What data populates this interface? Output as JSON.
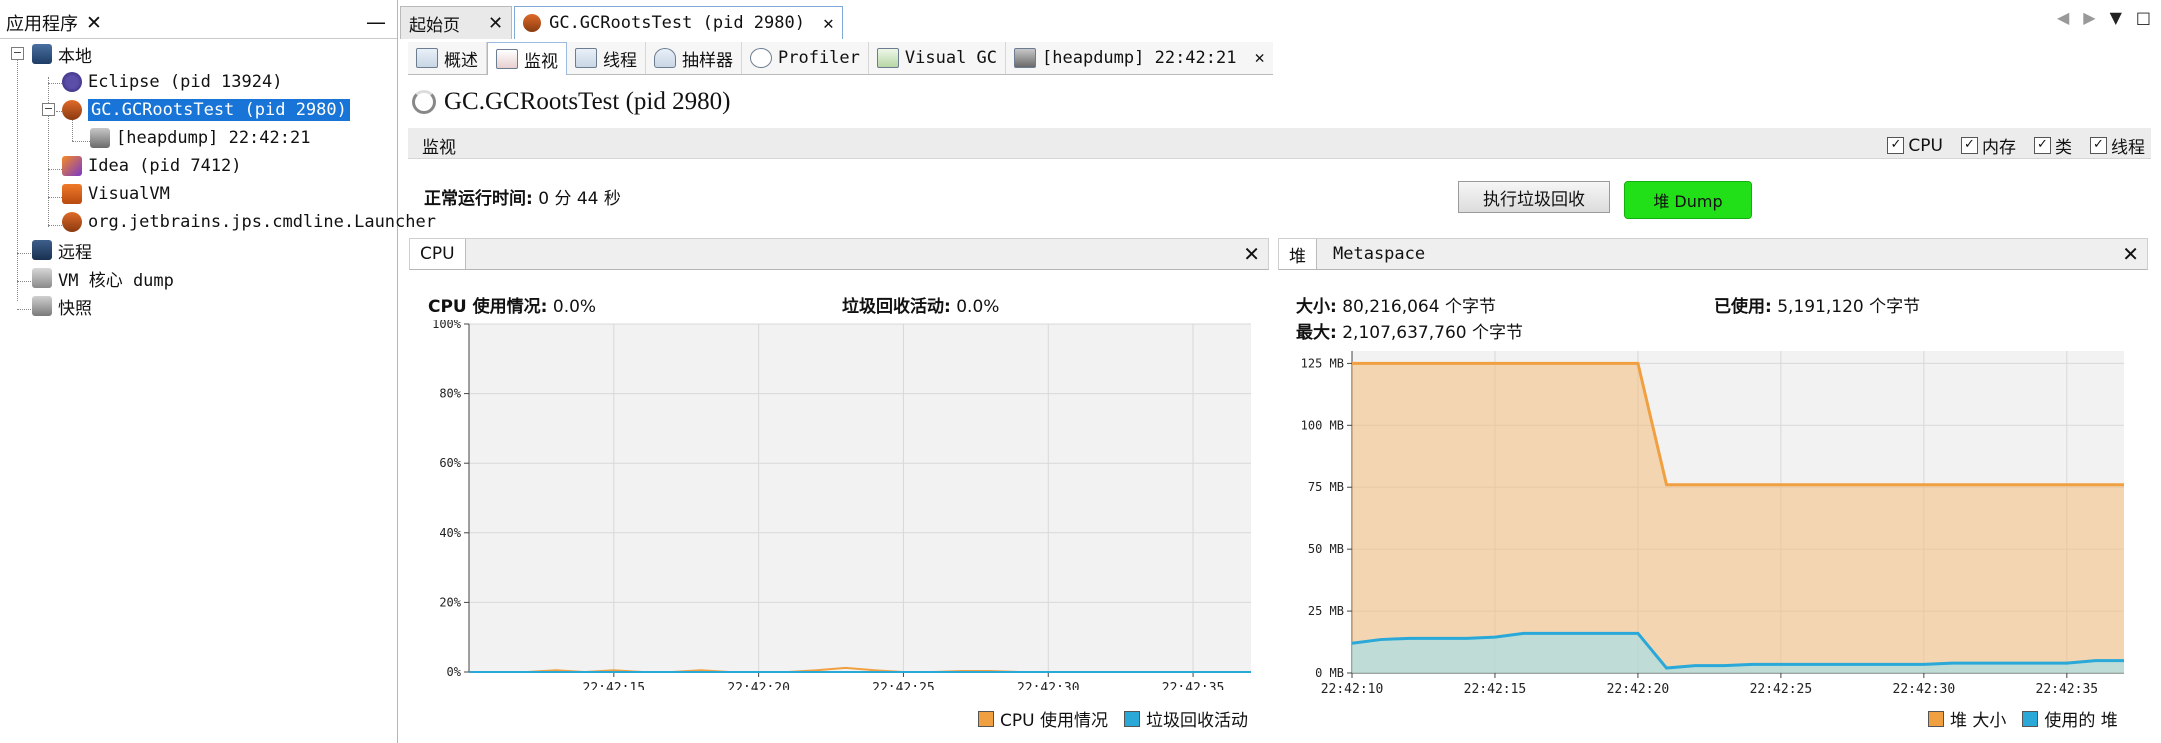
{
  "left_panel": {
    "tab_label": "应用程序",
    "close": "✕",
    "minimize": "—",
    "tree": {
      "local": "本地",
      "eclipse": "Eclipse (pid 13924)",
      "gcroots": "GC.GCRootsTest (pid 2980)",
      "heapdump": "[heapdump] 22:42:21",
      "idea": "Idea (pid 7412)",
      "visualvm": "VisualVM",
      "launcher": "org.jetbrains.jps.cmdline.Launcher",
      "remote": "远程",
      "coredump": "VM 核心 dump",
      "snapshot": "快照"
    },
    "toggle_minus": "−"
  },
  "main_tabs": [
    {
      "label": "起始页"
    },
    {
      "label": "GC.GCRootsTest (pid 2980)"
    }
  ],
  "close_x": "✕",
  "nav": {
    "left": "◀",
    "right": "▶",
    "down": "▼",
    "max": "□"
  },
  "sub_tabs": [
    {
      "label": "概述"
    },
    {
      "label": "监视"
    },
    {
      "label": "线程"
    },
    {
      "label": "抽样器"
    },
    {
      "label": "Profiler"
    },
    {
      "label": "Visual GC"
    },
    {
      "label": "[heapdump] 22:42:21"
    }
  ],
  "process_title": "GC.GCRootsTest (pid 2980)",
  "monitor": {
    "label": "监视",
    "checks": [
      {
        "label": "CPU",
        "checked": true
      },
      {
        "label": "内存",
        "checked": true
      },
      {
        "label": "类",
        "checked": true
      },
      {
        "label": "线程",
        "checked": true
      }
    ],
    "check_mark": "✓"
  },
  "uptime": {
    "label": "正常运行时间:",
    "value": "0 分 44 秒"
  },
  "buttons": {
    "gc": "执行垃圾回收",
    "heap_dump": "堆 Dump"
  },
  "cpu_panel": {
    "tab": "CPU",
    "usage_label": "CPU 使用情况:",
    "usage_value": "0.0%",
    "gc_label": "垃圾回收活动:",
    "gc_value": "0.0%",
    "legend": [
      "CPU 使用情况",
      "垃圾回收活动"
    ]
  },
  "heap_panel": {
    "tabs": [
      "堆",
      "Metaspace"
    ],
    "size_label": "大小:",
    "size_value": "80,216,064 个字节",
    "used_label": "已使用:",
    "used_value": "5,191,120 个字节",
    "max_label": "最大:",
    "max_value": "2,107,637,760 个字节",
    "legend": [
      "堆 大小",
      "使用的 堆"
    ]
  },
  "colors": {
    "orange": "#f0a040",
    "blue": "#2aa8d8",
    "selected": "#1874d6",
    "heap_dump_button": "#22e018"
  },
  "chart_data": [
    {
      "type": "line",
      "title": "CPU",
      "x": [
        "22:42:10",
        "22:42:11",
        "22:42:12",
        "22:42:13",
        "22:42:14",
        "22:42:15",
        "22:42:16",
        "22:42:17",
        "22:42:18",
        "22:42:19",
        "22:42:20",
        "22:42:21",
        "22:42:22",
        "22:42:23",
        "22:42:24",
        "22:42:25",
        "22:42:26",
        "22:42:27",
        "22:42:28",
        "22:42:29",
        "22:42:30",
        "22:42:31",
        "22:42:32",
        "22:42:33",
        "22:42:34",
        "22:42:35",
        "22:42:36",
        "22:42:37"
      ],
      "series": [
        {
          "name": "CPU 使用情况",
          "values": [
            0,
            0,
            0,
            0.5,
            0,
            0.5,
            0,
            0,
            0.5,
            0,
            0,
            0,
            0.5,
            1.2,
            0.5,
            0,
            0,
            0.3,
            0.3,
            0,
            0,
            0,
            0,
            0,
            0,
            0,
            0,
            0
          ]
        },
        {
          "name": "垃圾回收活动",
          "values": [
            0,
            0,
            0,
            0,
            0,
            0,
            0,
            0,
            0,
            0,
            0,
            0,
            0,
            0,
            0,
            0,
            0,
            0,
            0,
            0,
            0,
            0,
            0,
            0,
            0,
            0,
            0,
            0
          ]
        }
      ],
      "x_ticks": [
        "22:42:15",
        "22:42:20",
        "22:42:25",
        "22:42:30",
        "22:42:35"
      ],
      "y_ticks": [
        "0%",
        "20%",
        "40%",
        "60%",
        "80%",
        "100%"
      ],
      "ylim": [
        0,
        100
      ],
      "grid": true
    },
    {
      "type": "area",
      "title": "堆",
      "x": [
        "22:42:10",
        "22:42:11",
        "22:42:12",
        "22:42:13",
        "22:42:14",
        "22:42:15",
        "22:42:16",
        "22:42:17",
        "22:42:18",
        "22:42:19",
        "22:42:20",
        "22:42:21",
        "22:42:22",
        "22:42:23",
        "22:42:24",
        "22:42:25",
        "22:42:26",
        "22:42:27",
        "22:42:28",
        "22:42:29",
        "22:42:30",
        "22:42:31",
        "22:42:32",
        "22:42:33",
        "22:42:34",
        "22:42:35",
        "22:42:36",
        "22:42:37"
      ],
      "series": [
        {
          "name": "堆 大小",
          "values": [
            125,
            125,
            125,
            125,
            125,
            125,
            125,
            125,
            125,
            125,
            125,
            76,
            76,
            76,
            76,
            76,
            76,
            76,
            76,
            76,
            76,
            76,
            76,
            76,
            76,
            76,
            76,
            76
          ]
        },
        {
          "name": "使用的 堆",
          "values": [
            12,
            13.5,
            14,
            14,
            14,
            14.5,
            16,
            16,
            16,
            16,
            16,
            2,
            3,
            3,
            3.5,
            3.5,
            3.5,
            3.5,
            3.5,
            3.5,
            3.5,
            4,
            4,
            4,
            4,
            4,
            5,
            5
          ]
        }
      ],
      "x_ticks": [
        "22:42:10",
        "22:42:15",
        "22:42:20",
        "22:42:25",
        "22:42:30",
        "22:42:35"
      ],
      "y_ticks": [
        "0 MB",
        "25 MB",
        "50 MB",
        "75 MB",
        "100 MB",
        "125 MB"
      ],
      "ylim": [
        0,
        130
      ],
      "grid": true
    }
  ]
}
